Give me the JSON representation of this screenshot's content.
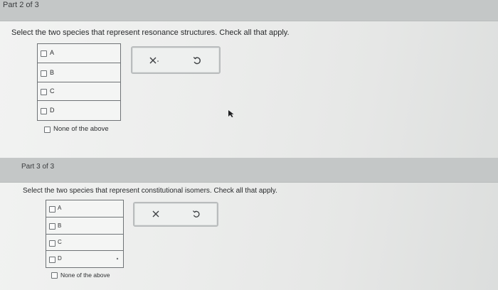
{
  "part2": {
    "header": "Part 2 of 3",
    "prompt": "Select the two species that represent resonance structures. Check all that apply.",
    "options": [
      {
        "label": "A"
      },
      {
        "label": "B"
      },
      {
        "label": "C"
      },
      {
        "label": "D"
      }
    ],
    "none_label": "None of the above",
    "clear_icon": "x-icon",
    "reset_icon": "undo-icon"
  },
  "part3": {
    "header": "Part 3 of 3",
    "prompt": "Select the two species that represent constitutional isomers. Check all that apply.",
    "options": [
      {
        "label": "A"
      },
      {
        "label": "B"
      },
      {
        "label": "C"
      },
      {
        "label": "D"
      }
    ],
    "none_label": "None of the above",
    "clear_icon": "x-icon",
    "reset_icon": "undo-icon"
  },
  "colors": {
    "header_bg": "#c4c7c7",
    "table_border": "#6f7376",
    "page_bg": "#ecedec"
  }
}
